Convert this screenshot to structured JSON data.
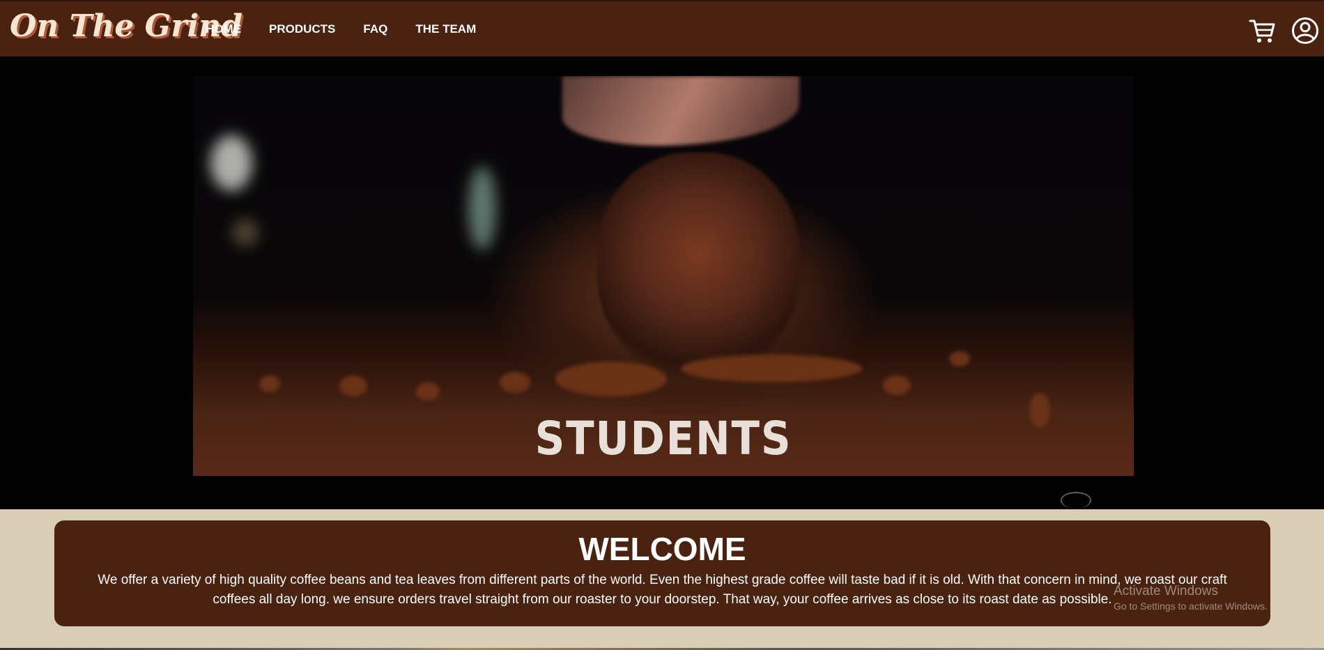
{
  "header": {
    "logo": "On The Grind",
    "nav": [
      {
        "label": "HOME"
      },
      {
        "label": "PRODUCTS"
      },
      {
        "label": "FAQ"
      },
      {
        "label": "THE TEAM"
      }
    ],
    "icons": [
      "cart-icon",
      "user-icon"
    ]
  },
  "video": {
    "caption": "STUDENTS"
  },
  "welcome": {
    "title": "WELCOME",
    "text": "We offer a variety of high quality coffee beans and tea leaves from different parts of the world. Even the highest grade coffee will taste bad if it is old. With that concern in mind, we roast our craft coffees all day long. we ensure orders travel straight from our roaster to your doorstep. That way, your coffee arrives as close to its roast date as possible."
  },
  "watermark": {
    "title": "Activate Windows",
    "subtitle": "Go to Settings to activate Windows."
  },
  "colors": {
    "brown": "#4a2210",
    "beige": "#d9cdb6",
    "white": "#ffffff"
  }
}
